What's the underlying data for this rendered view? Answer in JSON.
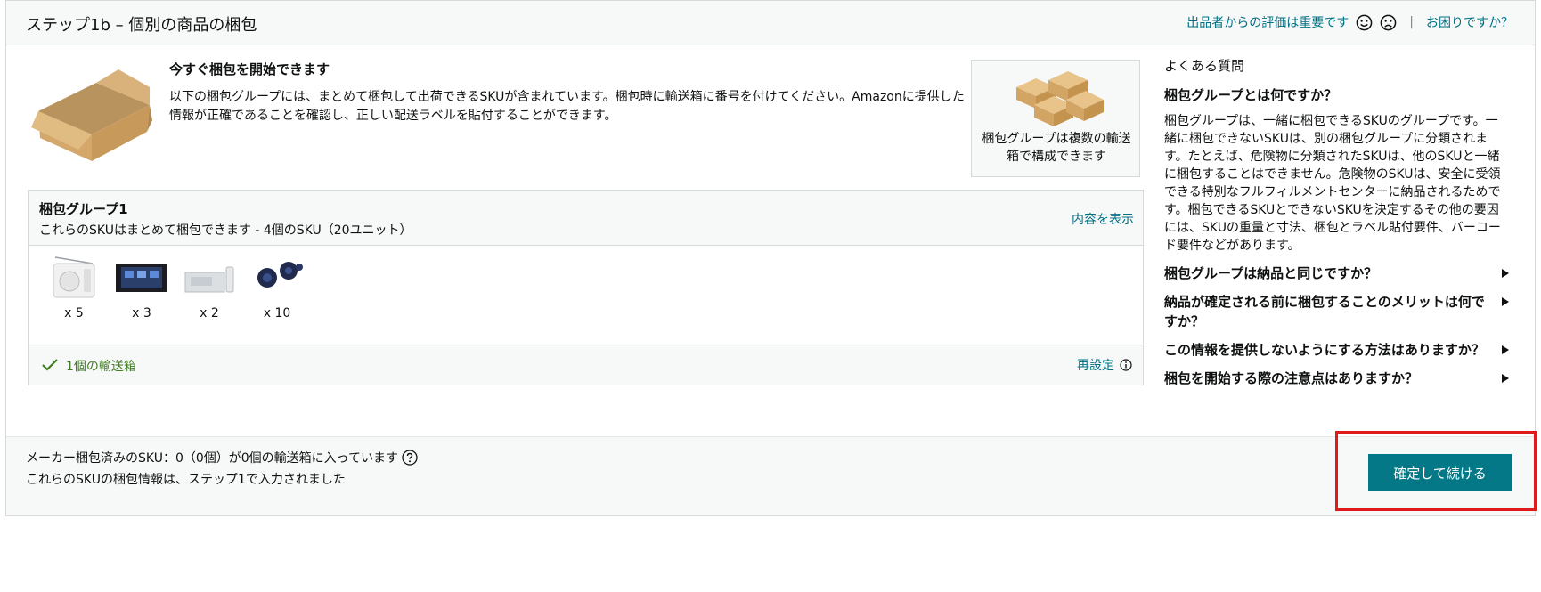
{
  "header": {
    "title": "ステップ1b – 個別の商品の梱包",
    "feedback_label": "出品者からの評価は重要です",
    "separator": "|",
    "help_label": "お困りですか？"
  },
  "intro": {
    "title": "今すぐ梱包を開始できます",
    "text": "以下の梱包グループには、まとめて梱包して出荷できるSKUが含まれています。梱包時に輸送箱に番号を付けてください。Amazonに提供した情報が正確であることを確認し、正しい配送ラベルを貼付することができます。"
  },
  "group_card": {
    "text": "梱包グループは複数の輸送箱で構成できます"
  },
  "pack_group": {
    "title": "梱包グループ1",
    "subtitle": "これらのSKUはまとめて梱包できます - 4個のSKU（20ユニット）",
    "view_label": "内容を表示",
    "products": [
      {
        "qty": "x 5",
        "icon": "radio-icon"
      },
      {
        "qty": "x 3",
        "icon": "car-stereo-icon"
      },
      {
        "qty": "x 2",
        "icon": "cd-player-icon"
      },
      {
        "qty": "x 10",
        "icon": "earbuds-icon"
      }
    ],
    "box_count": "1個の輸送箱",
    "reset_label": "再設定"
  },
  "faq": {
    "heading": "よくある質問",
    "main_question": "梱包グループとは何ですか？",
    "main_answer": "梱包グループは、一緒に梱包できるSKUのグループです。一緒に梱包できないSKUは、別の梱包グループに分類されます。たとえば、危険物に分類されたSKUは、他のSKUと一緒に梱包することはできません。危険物のSKUは、安全に受領できる特別なフルフィルメントセンターに納品されるためです。梱包できるSKUとできないSKUを決定するその他の要因には、SKUの重量と寸法、梱包とラベル貼付要件、バーコード要件などがあります。",
    "items": [
      "梱包グループは納品と同じですか？",
      "納品が確定される前に梱包することのメリットは何ですか？",
      "この情報を提供しないようにする方法はありますか？",
      "梱包を開始する際の注意点はありますか？"
    ]
  },
  "footer": {
    "line1": "メーカー梱包済みのSKU：0（0個）が0個の輸送箱に入っています",
    "line2": "これらのSKUの梱包情報は、ステップ1で入力されました",
    "confirm_label": "確定して続ける"
  },
  "colors": {
    "link": "#007185",
    "button": "#057888",
    "success": "#3f7a21",
    "highlight": "#e0191b"
  }
}
